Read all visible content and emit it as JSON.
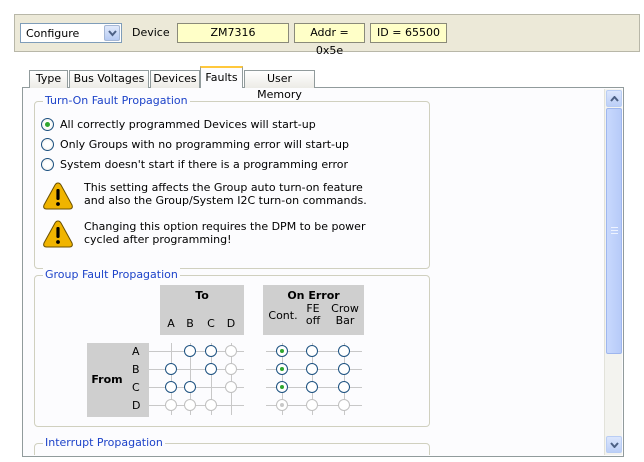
{
  "header": {
    "mode_select": "Configure",
    "device_label": "Device",
    "device_value": "ZM7316",
    "addr_value": "Addr = 0x5e",
    "id_value": "ID = 65500"
  },
  "tabs": [
    {
      "label": "Type",
      "active": false
    },
    {
      "label": "Bus Voltages",
      "active": false
    },
    {
      "label": "Devices",
      "active": false
    },
    {
      "label": "Faults",
      "active": true
    },
    {
      "label": "User Memory",
      "active": false
    }
  ],
  "turn_on": {
    "legend": "Turn-On Fault Propagation",
    "options": [
      {
        "label": "All correctly programmed Devices will start-up",
        "selected": true
      },
      {
        "label": "Only Groups with no programming error will start-up",
        "selected": false
      },
      {
        "label": "System doesn't start if there is a programming error",
        "selected": false
      }
    ],
    "warnings": [
      {
        "line1": "This setting affects the Group auto turn-on feature",
        "line2": "and also the Group/System I2C turn-on commands."
      },
      {
        "line1": "Changing this option requires  the DPM to be power",
        "line2": "cycled  after programming!"
      }
    ]
  },
  "group_fault": {
    "legend": "Group Fault Propagation",
    "to_title": "To",
    "to_cols": [
      "A",
      "B",
      "C",
      "D"
    ],
    "error_title": "On Error",
    "error_cols": [
      {
        "line1": "Cont.",
        "line2": ""
      },
      {
        "line1": "FE",
        "line2": "off"
      },
      {
        "line1": "Crow",
        "line2": "Bar"
      }
    ],
    "from_title": "From",
    "rows": [
      "A",
      "B",
      "C",
      "D"
    ],
    "to_matrix": [
      [
        false,
        true,
        true,
        true
      ],
      [
        true,
        false,
        true,
        true
      ],
      [
        true,
        true,
        false,
        true
      ],
      [
        true,
        true,
        true,
        false
      ]
    ],
    "on_error": [
      0,
      0,
      0,
      0
    ]
  },
  "interrupt": {
    "legend": "Interrupt Propagation"
  }
}
